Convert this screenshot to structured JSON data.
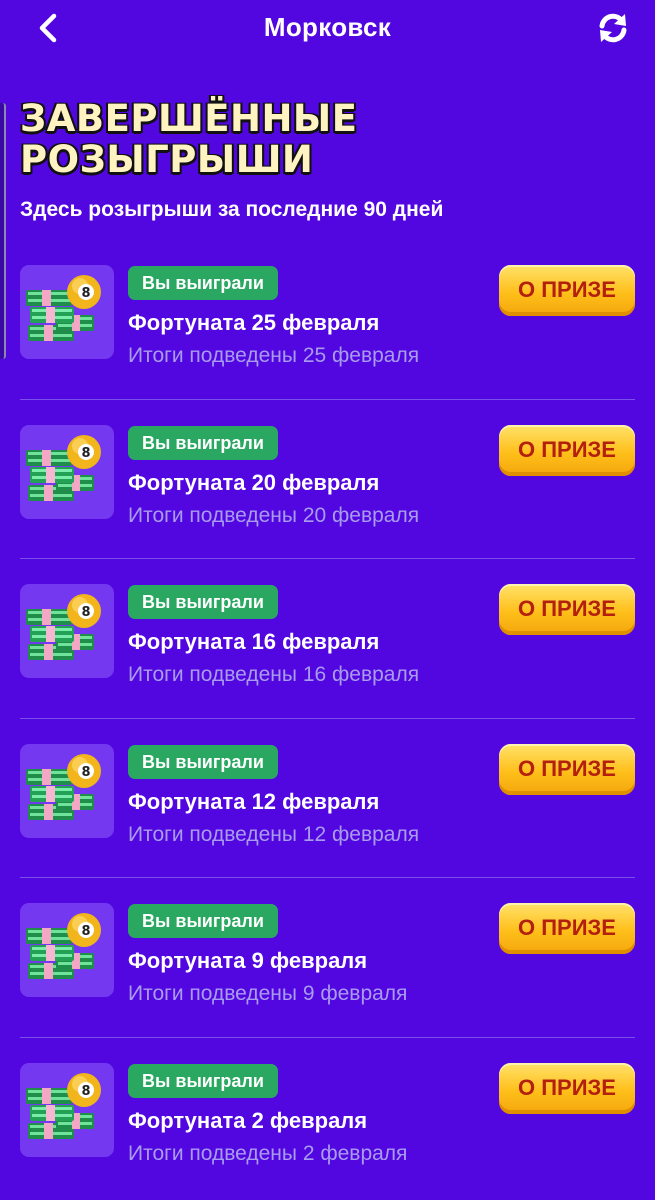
{
  "header": {
    "title": "Морковск",
    "back_icon": "chevron-left-icon",
    "refresh_icon": "refresh-icon"
  },
  "page": {
    "heading_line1": "ЗАВЕРШЁННЫЕ",
    "heading_line2": "РОЗЫГРЫШИ",
    "subtitle": "Здесь розыгрыши за последние 90 дней"
  },
  "colors": {
    "background": "#5206e0",
    "badge": "#2aa862",
    "button": "#ffc727",
    "button_text": "#b3200e",
    "heading": "#fff3c2",
    "secondary_text": "#a89cef"
  },
  "draws": [
    {
      "badge": "Вы выиграли",
      "title": "Фортуната 25 февраля",
      "result": "Итоги подведены 25 февраля",
      "button": "О ПРИЗЕ"
    },
    {
      "badge": "Вы выиграли",
      "title": "Фортуната 20 февраля",
      "result": "Итоги подведены 20 февраля",
      "button": "О ПРИЗЕ"
    },
    {
      "badge": "Вы выиграли",
      "title": "Фортуната 16 февраля",
      "result": "Итоги подведены 16 февраля",
      "button": "О ПРИЗЕ"
    },
    {
      "badge": "Вы выиграли",
      "title": "Фортуната 12 февраля",
      "result": "Итоги подведены 12 февраля",
      "button": "О ПРИЗЕ"
    },
    {
      "badge": "Вы выиграли",
      "title": "Фортуната 9 февраля",
      "result": "Итоги подведены 9 февраля",
      "button": "О ПРИЗЕ"
    },
    {
      "badge": "Вы выиграли",
      "title": "Фортуната 2 февраля",
      "result": "Итоги подведены 2 февраля",
      "button": "О ПРИЗЕ"
    }
  ]
}
